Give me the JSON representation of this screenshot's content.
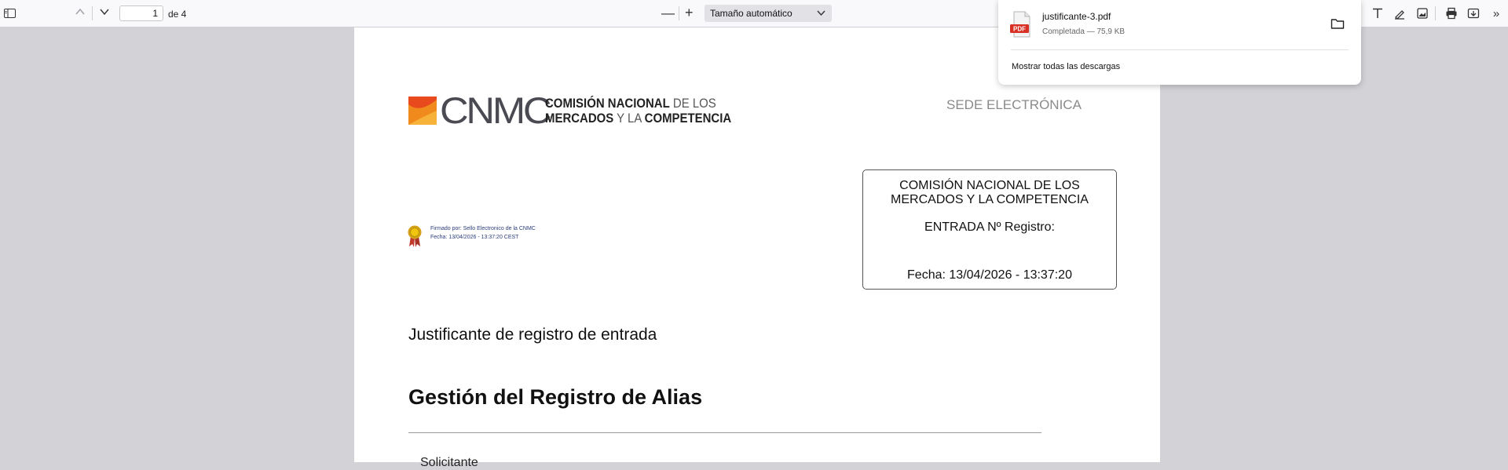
{
  "toolbar": {
    "page_current": "1",
    "page_total": "de 4",
    "zoom_out_label": "—",
    "zoom_in_label": "+",
    "zoom_value": "Tamaño automático",
    "more_label": "»"
  },
  "document": {
    "logo_acronym": "CNMC",
    "logo_line1_bold": "COMISIÓN NACIONAL",
    "logo_line1_light": " DE LOS",
    "logo_line2_bold": "MERCADOS",
    "logo_line2_light": " Y LA ",
    "logo_line2_bold2": "COMPETENCIA",
    "sede": "SEDE ELECTRÓNICA",
    "registro_org_line1": "COMISIÓN NACIONAL DE LOS",
    "registro_org_line2": "MERCADOS Y LA COMPETENCIA",
    "registro_entrada": "ENTRADA Nº Registro:",
    "registro_fecha": "Fecha: 13/04/2026 - 13:37:20",
    "firma_line1": "Firmado por: Sello Electronico de la CNMC",
    "firma_line2": "Fecha: 13/04/2026 - 13:37:20 CEST",
    "subtitle": "Justificante de registro de entrada",
    "title": "Gestión del Registro de Alias",
    "next_section": "Solicitante"
  },
  "downloads": {
    "file_name": "justificante-3.pdf",
    "file_status": "Completada — 75,9 KB",
    "file_badge": "PDF",
    "show_all": "Mostrar todas las descargas"
  },
  "colors": {
    "toolbar_bg": "#f9f9fb",
    "viewer_bg": "#d3d3d7",
    "logo_orange": "#f08a1c",
    "logo_red": "#e8491d",
    "pdf_badge": "#d93025"
  }
}
